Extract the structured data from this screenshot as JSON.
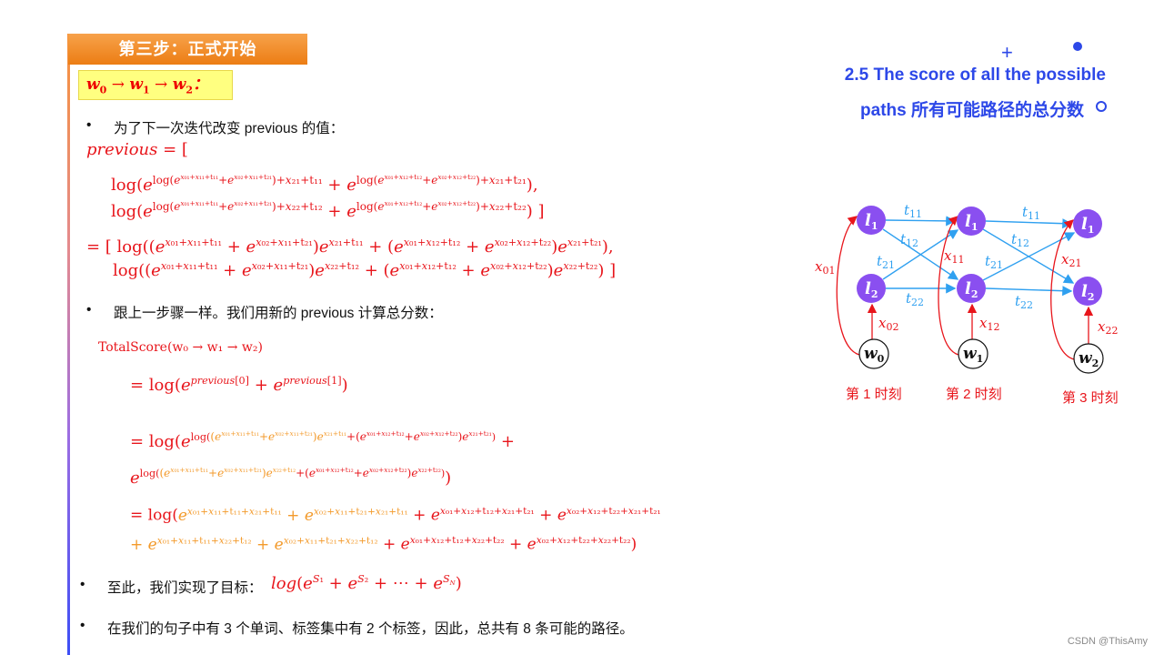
{
  "step_header": "第三步：正式开始",
  "path_box": {
    "w0": "w",
    "s0": "0",
    "arrow": " → ",
    "w1": "w",
    "s1": "1",
    "w2": "w",
    "s2": "2",
    "colon": "："
  },
  "bullets": [
    "为了下一次迭代改变 previous 的值：",
    "跟上一步骤一样。我们用新的 previous 计算总分数：",
    "至此，我们实现了目标：",
    "在我们的句子中有 3 个单词、标签集中有 2 个标签，因此，总共有 8 条可能的路径。"
  ],
  "bullet_symbol": "•",
  "formulas": {
    "previous_open": "previous = [",
    "prev_line1": "log(e^{log(e^{x01+x11+t11}+e^{x02+x11+t21})+x21+t11} + e^{log(e^{x01+x12+t12}+e^{x02+x12+t22})+x21+t21}),",
    "prev_line2": "log(e^{log(e^{x01+x11+t11}+e^{x02+x11+t21})+x22+t12} + e^{log(e^{x01+x12+t12}+e^{x02+x12+t22})+x22+t22}) ]",
    "eq_line1": "= [ log((e^{x01+x11+t11} + e^{x02+x11+t21})e^{x21+t11} + (e^{x01+x12+t12} + e^{x02+x12+t22})e^{x21+t21}),",
    "eq_line2": "log((e^{x01+x11+t11} + e^{x02+x11+t21})e^{x22+t12} + (e^{x01+x12+t12} + e^{x02+x12+t22})e^{x22+t22}) ]",
    "total_score": "TotalScore(w0 → w1 → w2)",
    "ts_line1": "= log(e^{previous[0]} + e^{previous[1]})",
    "ts_line2a": "= log(e^{log((e^{x01+x11+t11}+e^{x02+x11+t21})e^{x21+t11}+(e^{x01+x12+t12}+e^{x02+x12+t22})e^{x21+t21})} +",
    "ts_line2b": "e^{log((e^{x01+x11+t11}+e^{x02+x11+t21})e^{x22+t12}+(e^{x01+x12+t12}+e^{x02+x12+t22})e^{x22+t22})})",
    "ts_line3a": "= log(e^{x01+x11+t11+x21+t11} + e^{x02+x11+t21+x21+t11} + e^{x01+x12+t12+x21+t21} + e^{x02+x12+t22+x21+t21}",
    "ts_line3b": "+ e^{x01+x11+t11+x22+t12} + e^{x02+x11+t21+x22+t12} + e^{x01+x12+t12+x22+t22} + e^{x02+x12+t22+x22+t22})",
    "goal": "log(e^{S1} + e^{S2} + ⋯ + e^{SN})"
  },
  "right_panel": {
    "title_line1": "2.5 The score of all the possible",
    "title_line2": "paths 所有可能路径的总分数",
    "plus_symbol": "+"
  },
  "diagram": {
    "label_nodes": [
      {
        "col": 1,
        "label": "l",
        "sub": "1"
      },
      {
        "col": 1,
        "label": "l",
        "sub": "2"
      },
      {
        "col": 2,
        "label": "l",
        "sub": "1"
      },
      {
        "col": 2,
        "label": "l",
        "sub": "2"
      },
      {
        "col": 3,
        "label": "l",
        "sub": "1"
      },
      {
        "col": 3,
        "label": "l",
        "sub": "2"
      }
    ],
    "word_nodes": [
      {
        "label": "w",
        "sub": "0"
      },
      {
        "label": "w",
        "sub": "1"
      },
      {
        "label": "w",
        "sub": "2"
      }
    ],
    "transition_labels": [
      "t11",
      "t12",
      "t21",
      "t22"
    ],
    "emission_labels": [
      "x01",
      "x02",
      "x11",
      "x12",
      "x21",
      "x22"
    ],
    "time_labels": [
      "第 1 时刻",
      "第 2 时刻",
      "第 3 时刻"
    ],
    "colors": {
      "node": "#8a4ff0",
      "transition": "#2fa0f0",
      "emission": "#e8151b",
      "title": "#2d48e8",
      "orange": "#f39a2b"
    }
  },
  "watermark": "CSDN @ThisAmy"
}
